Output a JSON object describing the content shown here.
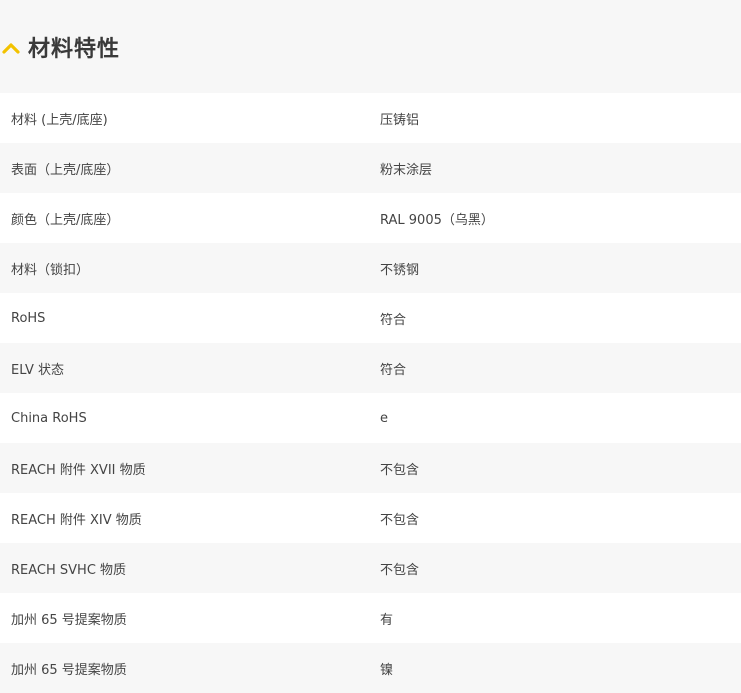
{
  "section": {
    "title": "材料特性",
    "accent_color": "#f2c200",
    "toggle_icon": "chevron-up-icon"
  },
  "rows": [
    {
      "key": "材料 (上壳/底座)",
      "value": "压铸铝"
    },
    {
      "key": "表面（上壳/底座）",
      "value": "粉末涂层"
    },
    {
      "key": "颜色（上壳/底座）",
      "value": "RAL 9005（乌黑）"
    },
    {
      "key": "材料（锁扣）",
      "value": "不锈钢"
    },
    {
      "key": "RoHS",
      "value": "符合"
    },
    {
      "key": "ELV 状态",
      "value": "符合"
    },
    {
      "key": "China RoHS",
      "value": "e"
    },
    {
      "key": "REACH 附件 XVII 物质",
      "value": "不包含"
    },
    {
      "key": "REACH 附件 XIV 物质",
      "value": "不包含"
    },
    {
      "key": "REACH SVHC 物质",
      "value": "不包含"
    },
    {
      "key": "加州 65 号提案物质",
      "value": "有"
    },
    {
      "key": "加州 65 号提案物质",
      "value": "镍"
    }
  ]
}
